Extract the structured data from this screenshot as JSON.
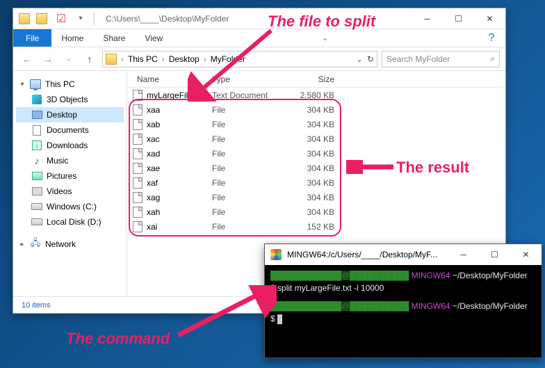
{
  "explorer": {
    "titlebar_path": "C:\\Users\\____\\Desktop\\MyFolder",
    "menu": {
      "file": "File",
      "home": "Home",
      "share": "Share",
      "view": "View"
    },
    "breadcrumbs": [
      "This PC",
      "Desktop",
      "MyFolder"
    ],
    "search_placeholder": "Search MyFolder",
    "refresh_label": "↻",
    "sidebar": [
      {
        "label": "This PC",
        "icon": "pc",
        "chevron": "▾"
      },
      {
        "label": "3D Objects",
        "icon": "3d",
        "indent": true
      },
      {
        "label": "Desktop",
        "icon": "desk",
        "indent": true,
        "selected": true
      },
      {
        "label": "Documents",
        "icon": "doc",
        "indent": true
      },
      {
        "label": "Downloads",
        "icon": "dl",
        "indent": true
      },
      {
        "label": "Music",
        "icon": "music",
        "indent": true
      },
      {
        "label": "Pictures",
        "icon": "pic",
        "indent": true
      },
      {
        "label": "Videos",
        "icon": "vid",
        "indent": true
      },
      {
        "label": "Windows (C:)",
        "icon": "drive",
        "indent": true
      },
      {
        "label": "Local Disk (D:)",
        "icon": "drive",
        "indent": true
      },
      {
        "label": "Network",
        "icon": "net",
        "chevron": "▸"
      }
    ],
    "columns": {
      "name": "Name",
      "type": "Type",
      "size": "Size"
    },
    "files": [
      {
        "name": "myLargeFile",
        "type": "Text Document",
        "size": "2,580 KB"
      },
      {
        "name": "xaa",
        "type": "File",
        "size": "304 KB"
      },
      {
        "name": "xab",
        "type": "File",
        "size": "304 KB"
      },
      {
        "name": "xac",
        "type": "File",
        "size": "304 KB"
      },
      {
        "name": "xad",
        "type": "File",
        "size": "304 KB"
      },
      {
        "name": "xae",
        "type": "File",
        "size": "304 KB"
      },
      {
        "name": "xaf",
        "type": "File",
        "size": "304 KB"
      },
      {
        "name": "xag",
        "type": "File",
        "size": "304 KB"
      },
      {
        "name": "xah",
        "type": "File",
        "size": "304 KB"
      },
      {
        "name": "xai",
        "type": "File",
        "size": "152 KB"
      }
    ],
    "status": "10 items"
  },
  "terminal": {
    "title": "MINGW64:/c/Users/____/Desktop/MyF...",
    "prompt_host_suffix": "MINGW64",
    "prompt_path": "~/Desktop/MyFolder",
    "command": "split myLargeFile.txt -l 10000"
  },
  "annotations": {
    "file_to_split": "The file to split",
    "result": "The result",
    "command": "The command"
  }
}
